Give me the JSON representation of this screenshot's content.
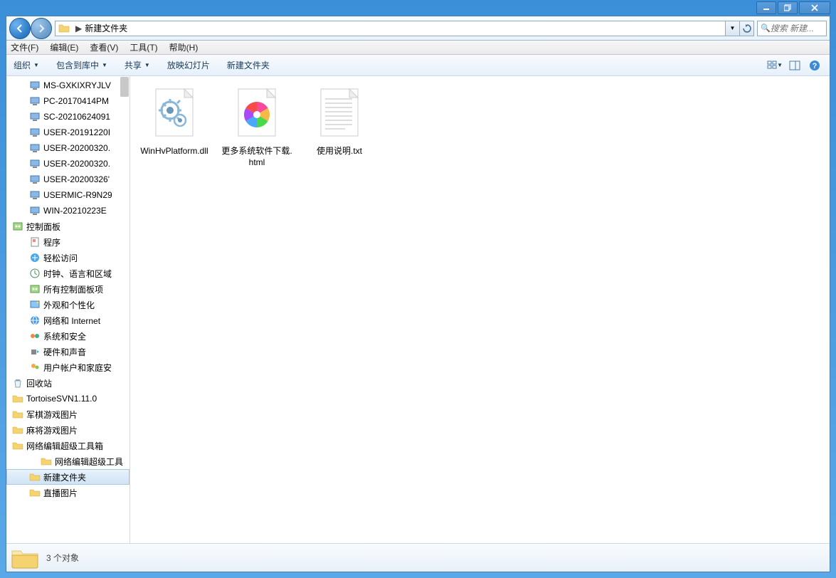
{
  "titlebar": {
    "minimize": "min",
    "restore": "restore",
    "close": "close"
  },
  "nav": {
    "path_sep": "▶",
    "current_folder": "新建文件夹",
    "search_placeholder": "搜索 新建..."
  },
  "menubar": [
    "文件(F)",
    "编辑(E)",
    "查看(V)",
    "工具(T)",
    "帮助(H)"
  ],
  "toolbar": {
    "organize": "组织",
    "include": "包含到库中",
    "share": "共享",
    "slideshow": "放映幻灯片",
    "newfolder": "新建文件夹"
  },
  "sidebar": {
    "items": [
      {
        "label": "MS-GXKIXRYJLV",
        "icon": "computer",
        "indent": 1
      },
      {
        "label": "PC-20170414PM",
        "icon": "computer",
        "indent": 1
      },
      {
        "label": "SC-20210624091",
        "icon": "computer",
        "indent": 1
      },
      {
        "label": "USER-20191220I",
        "icon": "computer",
        "indent": 1
      },
      {
        "label": "USER-20200320.",
        "icon": "computer",
        "indent": 1
      },
      {
        "label": "USER-20200320.",
        "icon": "computer",
        "indent": 1
      },
      {
        "label": "USER-20200326'",
        "icon": "computer",
        "indent": 1
      },
      {
        "label": "USERMIC-R9N29",
        "icon": "computer",
        "indent": 1
      },
      {
        "label": "WIN-20210223E",
        "icon": "computer",
        "indent": 1
      },
      {
        "label": "控制面板",
        "icon": "cpanel",
        "indent": 0
      },
      {
        "label": "程序",
        "icon": "programs",
        "indent": 1
      },
      {
        "label": "轻松访问",
        "icon": "ease",
        "indent": 1
      },
      {
        "label": "时钟、语言和区域",
        "icon": "clock",
        "indent": 1
      },
      {
        "label": "所有控制面板项",
        "icon": "cpanel",
        "indent": 1
      },
      {
        "label": "外观和个性化",
        "icon": "appearance",
        "indent": 1
      },
      {
        "label": "网络和 Internet",
        "icon": "network",
        "indent": 1
      },
      {
        "label": "系统和安全",
        "icon": "security",
        "indent": 1
      },
      {
        "label": "硬件和声音",
        "icon": "hardware",
        "indent": 1
      },
      {
        "label": "用户帐户和家庭安",
        "icon": "users",
        "indent": 1
      },
      {
        "label": "回收站",
        "icon": "recycle",
        "indent": 0
      },
      {
        "label": "TortoiseSVN1.11.0",
        "icon": "folder",
        "indent": 0
      },
      {
        "label": "军棋游戏图片",
        "icon": "folder",
        "indent": 0
      },
      {
        "label": "麻将游戏图片",
        "icon": "folder",
        "indent": 0
      },
      {
        "label": "网络编辑超级工具箱",
        "icon": "folder",
        "indent": 0
      },
      {
        "label": "网络编辑超级工具",
        "icon": "folder",
        "indent": 2
      },
      {
        "label": "新建文件夹",
        "icon": "folder",
        "indent": 1,
        "selected": true
      },
      {
        "label": "直播图片",
        "icon": "folder",
        "indent": 1
      }
    ]
  },
  "files": [
    {
      "name": "WinHvPlatform.dll",
      "type": "dll"
    },
    {
      "name": "更多系统软件下载.html",
      "type": "html"
    },
    {
      "name": "使用说明.txt",
      "type": "txt"
    }
  ],
  "status": {
    "count_text": "3 个对象"
  }
}
